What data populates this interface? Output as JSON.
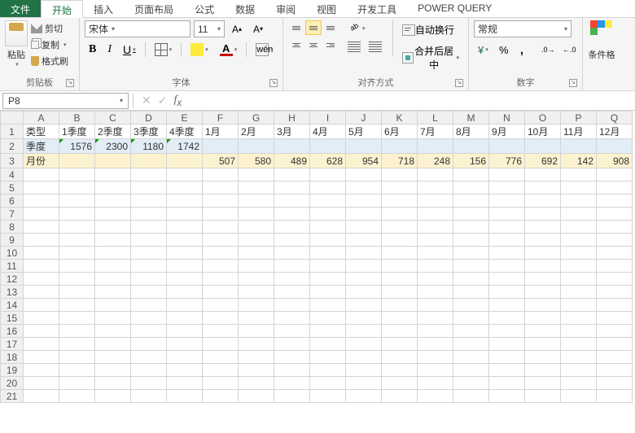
{
  "tabs": {
    "file": "文件",
    "home": "开始",
    "insert": "插入",
    "layout": "页面布局",
    "formula": "公式",
    "data": "数据",
    "review": "审阅",
    "view": "视图",
    "dev": "开发工具",
    "pq": "POWER QUERY"
  },
  "clipboard": {
    "paste": "粘贴",
    "cut": "剪切",
    "copy": "复制",
    "brush": "格式刷",
    "group": "剪贴板"
  },
  "font": {
    "name": "宋体",
    "size": "11",
    "group": "字体",
    "bold": "B",
    "italic": "I",
    "under": "U",
    "wen": "wén",
    "A": "A"
  },
  "align": {
    "group": "对齐方式",
    "wrap": "自动换行",
    "merge": "合并后居中"
  },
  "number": {
    "group": "数字",
    "format": "常规"
  },
  "styles": {
    "cond": "条件格"
  },
  "namebox": "P8",
  "chart_data": {
    "type": "table",
    "columns": [
      "A",
      "B",
      "C",
      "D",
      "E",
      "F",
      "G",
      "H",
      "I",
      "J",
      "K",
      "L",
      "M",
      "N",
      "O",
      "P",
      "Q"
    ],
    "rows": [
      {
        "hdr": "类型",
        "cells": [
          "1季度",
          "2季度",
          "3季度",
          "4季度",
          "1月",
          "2月",
          "3月",
          "4月",
          "5月",
          "6月",
          "7月",
          "8月",
          "9月",
          "10月",
          "11月",
          "12月"
        ]
      },
      {
        "hdr": "季度",
        "cells": [
          "1576",
          "2300",
          "1180",
          "1742",
          "",
          "",
          "",
          "",
          "",
          "",
          "",
          "",
          "",
          "",
          "",
          "",
          ""
        ]
      },
      {
        "hdr": "月份",
        "cells": [
          "",
          "",
          "",
          "",
          "507",
          "580",
          "489",
          "628",
          "954",
          "718",
          "248",
          "156",
          "776",
          "692",
          "142",
          "908"
        ]
      }
    ]
  },
  "rownums": [
    "1",
    "2",
    "3",
    "4",
    "5",
    "6",
    "7",
    "8",
    "9",
    "10",
    "11",
    "12",
    "13",
    "14",
    "15",
    "16",
    "17",
    "18",
    "19",
    "20",
    "21"
  ]
}
